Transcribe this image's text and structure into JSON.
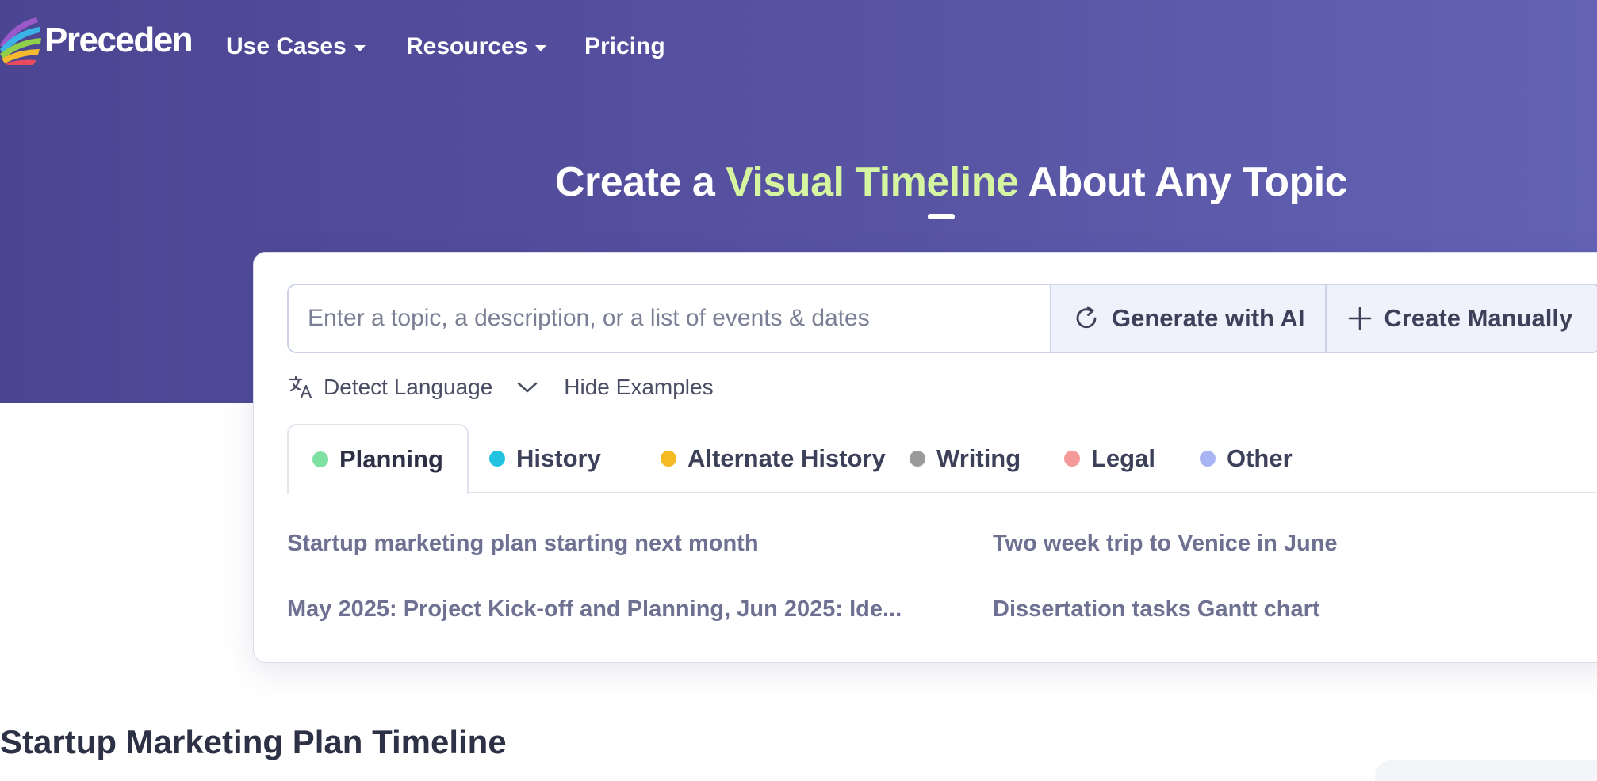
{
  "brand": {
    "name": "Preceden",
    "colors": [
      "#e84a5f",
      "#f5b82e",
      "#3bb2e6",
      "#8fcf4a",
      "#9a59c9"
    ]
  },
  "nav": {
    "items": [
      {
        "label": "Use Cases",
        "has_dropdown": true
      },
      {
        "label": "Resources",
        "has_dropdown": true
      },
      {
        "label": "Pricing",
        "has_dropdown": false
      }
    ]
  },
  "hero": {
    "headline_before": "Create a",
    "headline_accent": "Visual Timeline",
    "headline_after": "About Any Topic",
    "accent_color": "#d6f5a0",
    "background_color": "#55509f"
  },
  "form": {
    "topic_placeholder": "Enter a topic, a description, or a list of events & dates",
    "topic_value": "",
    "generate_label": "Generate with AI",
    "manual_label": "Create Manually",
    "language_label": "Detect Language",
    "hide_examples_label": "Hide Examples"
  },
  "tabs": [
    {
      "label": "Planning",
      "color": "#7ee0a2",
      "active": true
    },
    {
      "label": "History",
      "color": "#22c3e0",
      "active": false
    },
    {
      "label": "Alternate History",
      "color": "#f5b922",
      "active": false
    },
    {
      "label": "Writing",
      "color": "#9a9a9a",
      "active": false
    },
    {
      "label": "Legal",
      "color": "#f59a9a",
      "active": false
    },
    {
      "label": "Other",
      "color": "#a9b4f5",
      "active": false
    }
  ],
  "examples": [
    "Startup marketing plan starting next month",
    "Two week trip to Venice in June",
    "May 2025: Project Kick-off and Planning, Jun 2025: Ide...",
    "Dissertation tasks Gantt chart"
  ],
  "section": {
    "title": "Startup Marketing Plan Timeline"
  }
}
